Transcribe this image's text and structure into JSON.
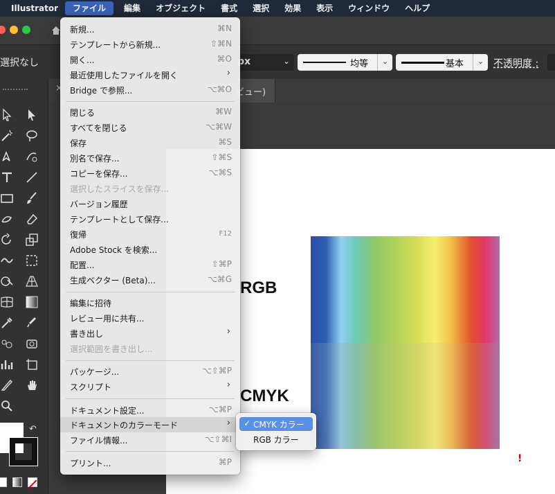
{
  "menubar": {
    "app": "Illustrator",
    "items": [
      "ファイル",
      "編集",
      "オブジェクト",
      "書式",
      "選択",
      "効果",
      "表示",
      "ウィンドウ",
      "ヘルプ"
    ],
    "active_index": 0
  },
  "control_bar": {
    "selection": "選択なし",
    "unit": "px",
    "stroke_profile": "均等",
    "brush": "基本",
    "opacity_label": "不透明度 :"
  },
  "doc_tab": {
    "label": "ビュー)"
  },
  "canvas": {
    "label_rgb": "RGB",
    "label_cmyk": "CMYK",
    "mark": "!"
  },
  "file_menu": {
    "items": [
      {
        "label": "新規...",
        "shortcut": "⌘N"
      },
      {
        "label": "テンプレートから新規...",
        "shortcut": "⇧⌘N"
      },
      {
        "label": "開く...",
        "shortcut": "⌘O"
      },
      {
        "label": "最近使用したファイルを開く",
        "submenu": "›"
      },
      {
        "label": "Bridge で参照...",
        "shortcut": "⌥⌘O"
      },
      {
        "label": "閉じる",
        "shortcut": "⌘W"
      },
      {
        "label": "すべてを閉じる",
        "shortcut": "⌥⌘W"
      },
      {
        "label": "保存",
        "shortcut": "⌘S"
      },
      {
        "label": "別名で保存...",
        "shortcut": "⇧⌘S"
      },
      {
        "label": "コピーを保存...",
        "shortcut": "⌥⌘S"
      },
      {
        "label": "選択したスライスを保存...",
        "disabled": true
      },
      {
        "label": "バージョン履歴"
      },
      {
        "label": "テンプレートとして保存..."
      },
      {
        "label": "復帰",
        "shortcut": "F12"
      },
      {
        "label": "Adobe Stock を検索..."
      },
      {
        "label": "配置...",
        "shortcut": "⇧⌘P"
      },
      {
        "label": "生成ベクター (Beta)...",
        "shortcut": "⌥⌘G"
      },
      {
        "label": "編集に招待"
      },
      {
        "label": "レビュー用に共有..."
      },
      {
        "label": "書き出し",
        "submenu": "›"
      },
      {
        "label": "選択範囲を書き出し...",
        "disabled": true
      },
      {
        "label": "パッケージ...",
        "shortcut": "⌥⇧⌘P"
      },
      {
        "label": "スクリプト",
        "submenu": "›"
      },
      {
        "label": "ドキュメント設定...",
        "shortcut": "⌥⌘P"
      },
      {
        "label": "ドキュメントのカラーモード",
        "submenu": "›",
        "highlighted": true
      },
      {
        "label": "ファイル情報...",
        "shortcut": "⌥⇧⌘I"
      },
      {
        "label": "プリント...",
        "shortcut": "⌘P"
      }
    ]
  },
  "color_mode_submenu": {
    "check": "✓",
    "items": [
      {
        "label": "CMYK カラー",
        "selected": true
      },
      {
        "label": "RGB カラー",
        "selected": false
      }
    ]
  },
  "colors": {
    "menubar_bg": "#1f2937",
    "menubar_active": "#3a63b8",
    "submenu_selected": "#5b8fe8"
  }
}
